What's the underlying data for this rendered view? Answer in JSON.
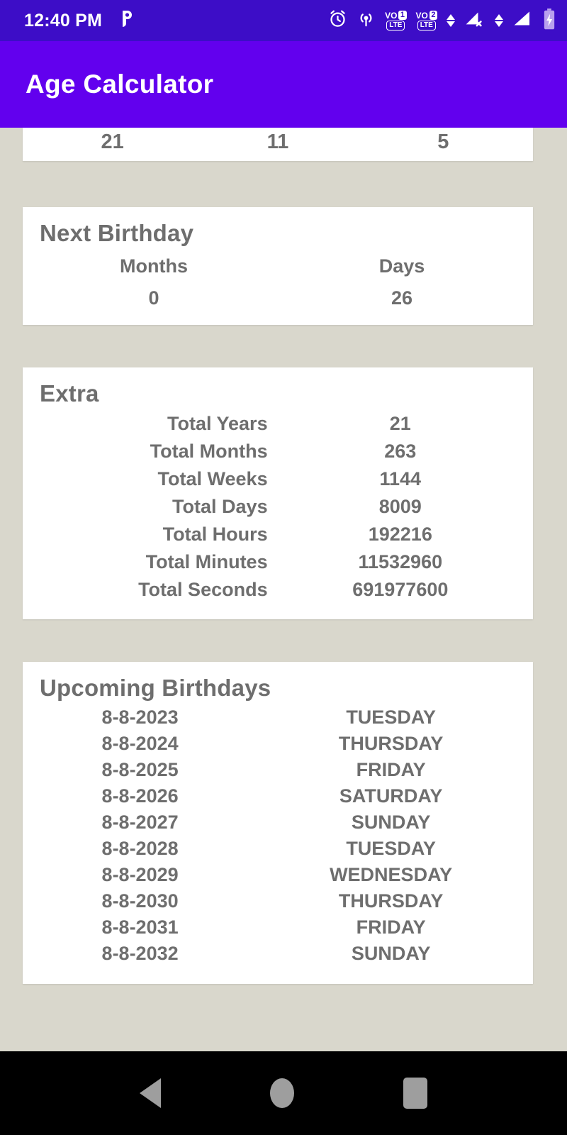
{
  "status_bar": {
    "time": "12:40 PM",
    "notification_icon": "phonepe-icon",
    "icons": [
      "alarm-icon",
      "hotspot-icon",
      "volte-sim1-icon",
      "volte-sim2-icon",
      "data-transfer-arrows-icon",
      "signal-no-service-icon",
      "signal-bars-icon",
      "battery-charging-icon"
    ],
    "volte1_label": "VO",
    "volte1_sim": "1",
    "volte1_tech": "LTE",
    "volte2_label": "VO",
    "volte2_sim": "2",
    "volte2_tech": "LTE",
    "background_color": "#3d0dc7"
  },
  "app_bar": {
    "title": "Age Calculator",
    "background_color": "#6200ee",
    "text_color": "#ffffff"
  },
  "clipped_card": {
    "values": [
      "21",
      "11",
      "5"
    ]
  },
  "next_birthday": {
    "title": "Next Birthday",
    "headers": [
      "Months",
      "Days"
    ],
    "values": [
      "0",
      "26"
    ]
  },
  "extra": {
    "title": "Extra",
    "rows": [
      {
        "label": "Total Years",
        "value": "21"
      },
      {
        "label": "Total Months",
        "value": "263"
      },
      {
        "label": "Total Weeks",
        "value": "1144"
      },
      {
        "label": "Total Days",
        "value": "8009"
      },
      {
        "label": "Total Hours",
        "value": "192216"
      },
      {
        "label": "Total Minutes",
        "value": "11532960"
      },
      {
        "label": "Total Seconds",
        "value": "691977600"
      }
    ]
  },
  "upcoming_birthdays": {
    "title": "Upcoming Birthdays",
    "rows": [
      {
        "date": "8-8-2023",
        "day": "TUESDAY"
      },
      {
        "date": "8-8-2024",
        "day": "THURSDAY"
      },
      {
        "date": "8-8-2025",
        "day": "FRIDAY"
      },
      {
        "date": "8-8-2026",
        "day": "SATURDAY"
      },
      {
        "date": "8-8-2027",
        "day": "SUNDAY"
      },
      {
        "date": "8-8-2028",
        "day": "TUESDAY"
      },
      {
        "date": "8-8-2029",
        "day": "WEDNESDAY"
      },
      {
        "date": "8-8-2030",
        "day": "THURSDAY"
      },
      {
        "date": "8-8-2031",
        "day": "FRIDAY"
      },
      {
        "date": "8-8-2032",
        "day": "SUNDAY"
      }
    ]
  },
  "nav_bar": {
    "back_label": "back-button",
    "home_label": "home-button",
    "recents_label": "recents-button",
    "background_color": "#000000",
    "icon_color": "#9e9e9e"
  },
  "theme": {
    "page_background": "#d9d7cc",
    "card_background": "#ffffff",
    "text_color": "#6e6e6e"
  }
}
